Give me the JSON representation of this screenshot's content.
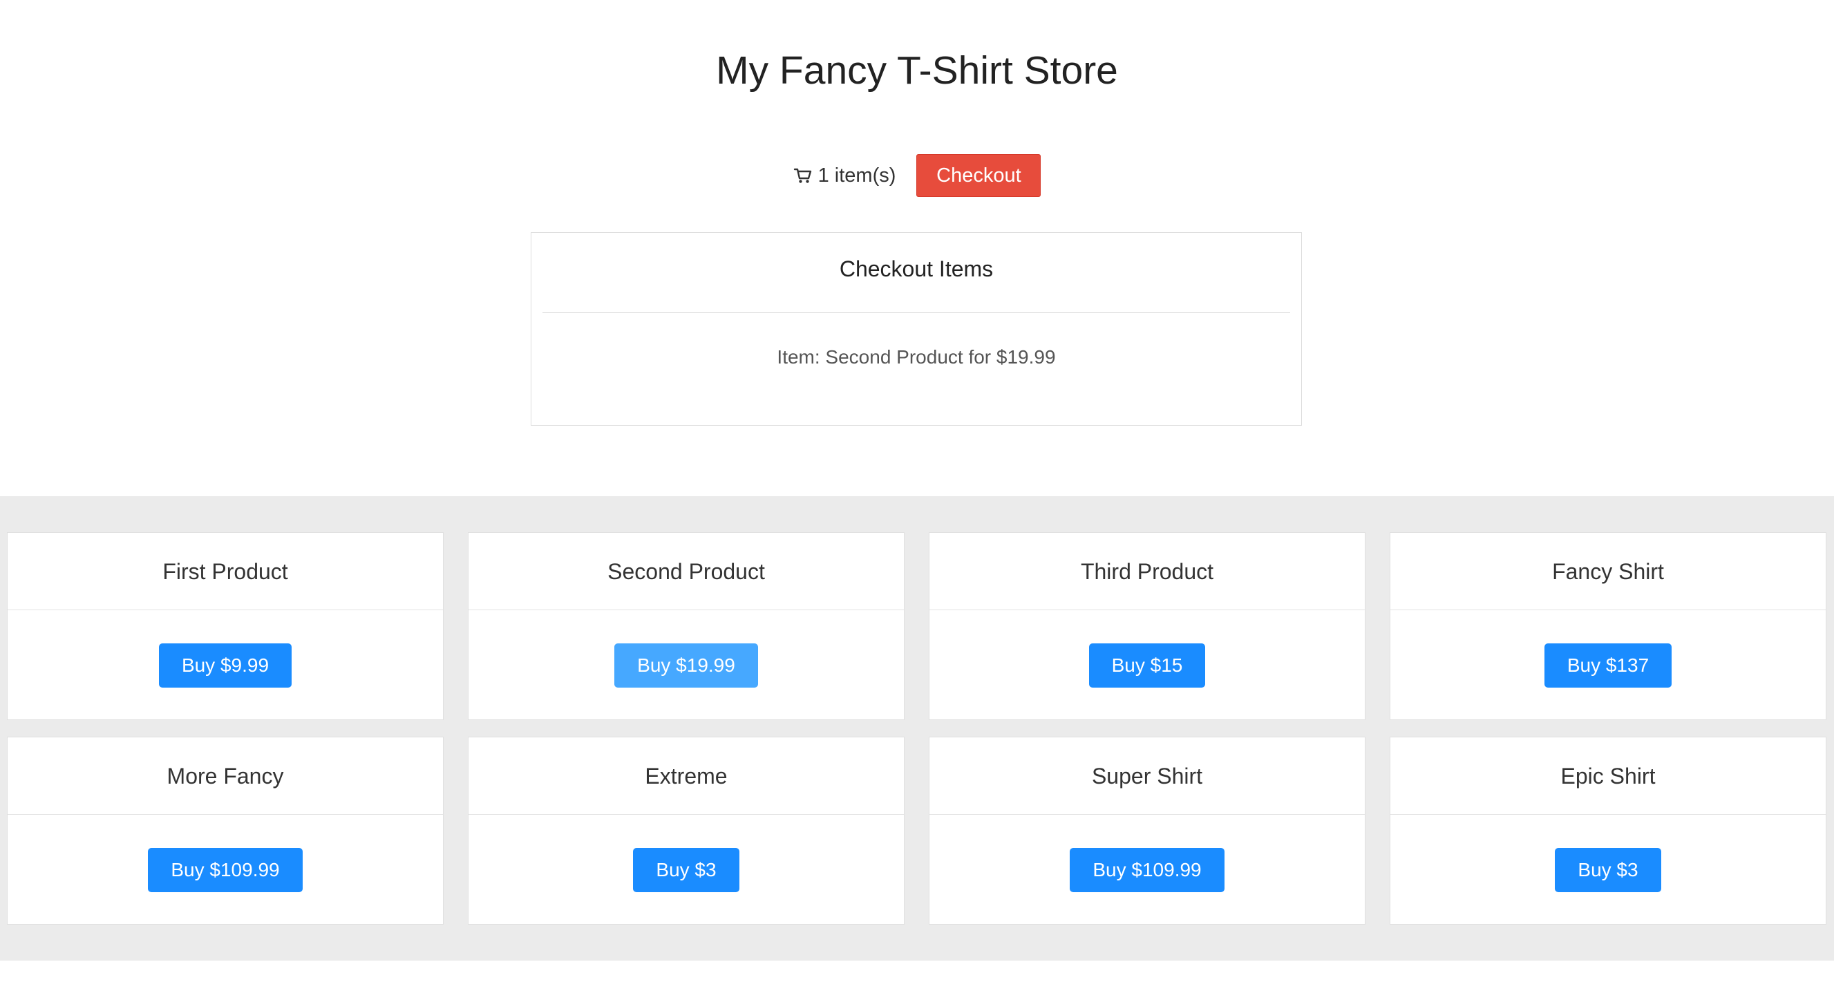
{
  "store": {
    "title": "My Fancy T-Shirt Store"
  },
  "cart": {
    "icon": "shopping-cart-icon",
    "count_label": "1 item(s)",
    "checkout_label": "Checkout"
  },
  "checkout_panel": {
    "title": "Checkout Items",
    "items": [
      "Item: Second Product for $19.99"
    ]
  },
  "products": [
    {
      "name": "First Product",
      "buy_label": "Buy $9.99",
      "active": false
    },
    {
      "name": "Second Product",
      "buy_label": "Buy $19.99",
      "active": true
    },
    {
      "name": "Third Product",
      "buy_label": "Buy $15",
      "active": false
    },
    {
      "name": "Fancy Shirt",
      "buy_label": "Buy $137",
      "active": false
    },
    {
      "name": "More Fancy",
      "buy_label": "Buy $109.99",
      "active": false
    },
    {
      "name": "Extreme",
      "buy_label": "Buy $3",
      "active": false
    },
    {
      "name": "Super Shirt",
      "buy_label": "Buy $109.99",
      "active": false
    },
    {
      "name": "Epic Shirt",
      "buy_label": "Buy $3",
      "active": false
    }
  ],
  "colors": {
    "checkout_button": "#e74c3c",
    "buy_button": "#1a8cff",
    "buy_button_active": "#46a8ff",
    "products_background": "#ebebeb"
  }
}
